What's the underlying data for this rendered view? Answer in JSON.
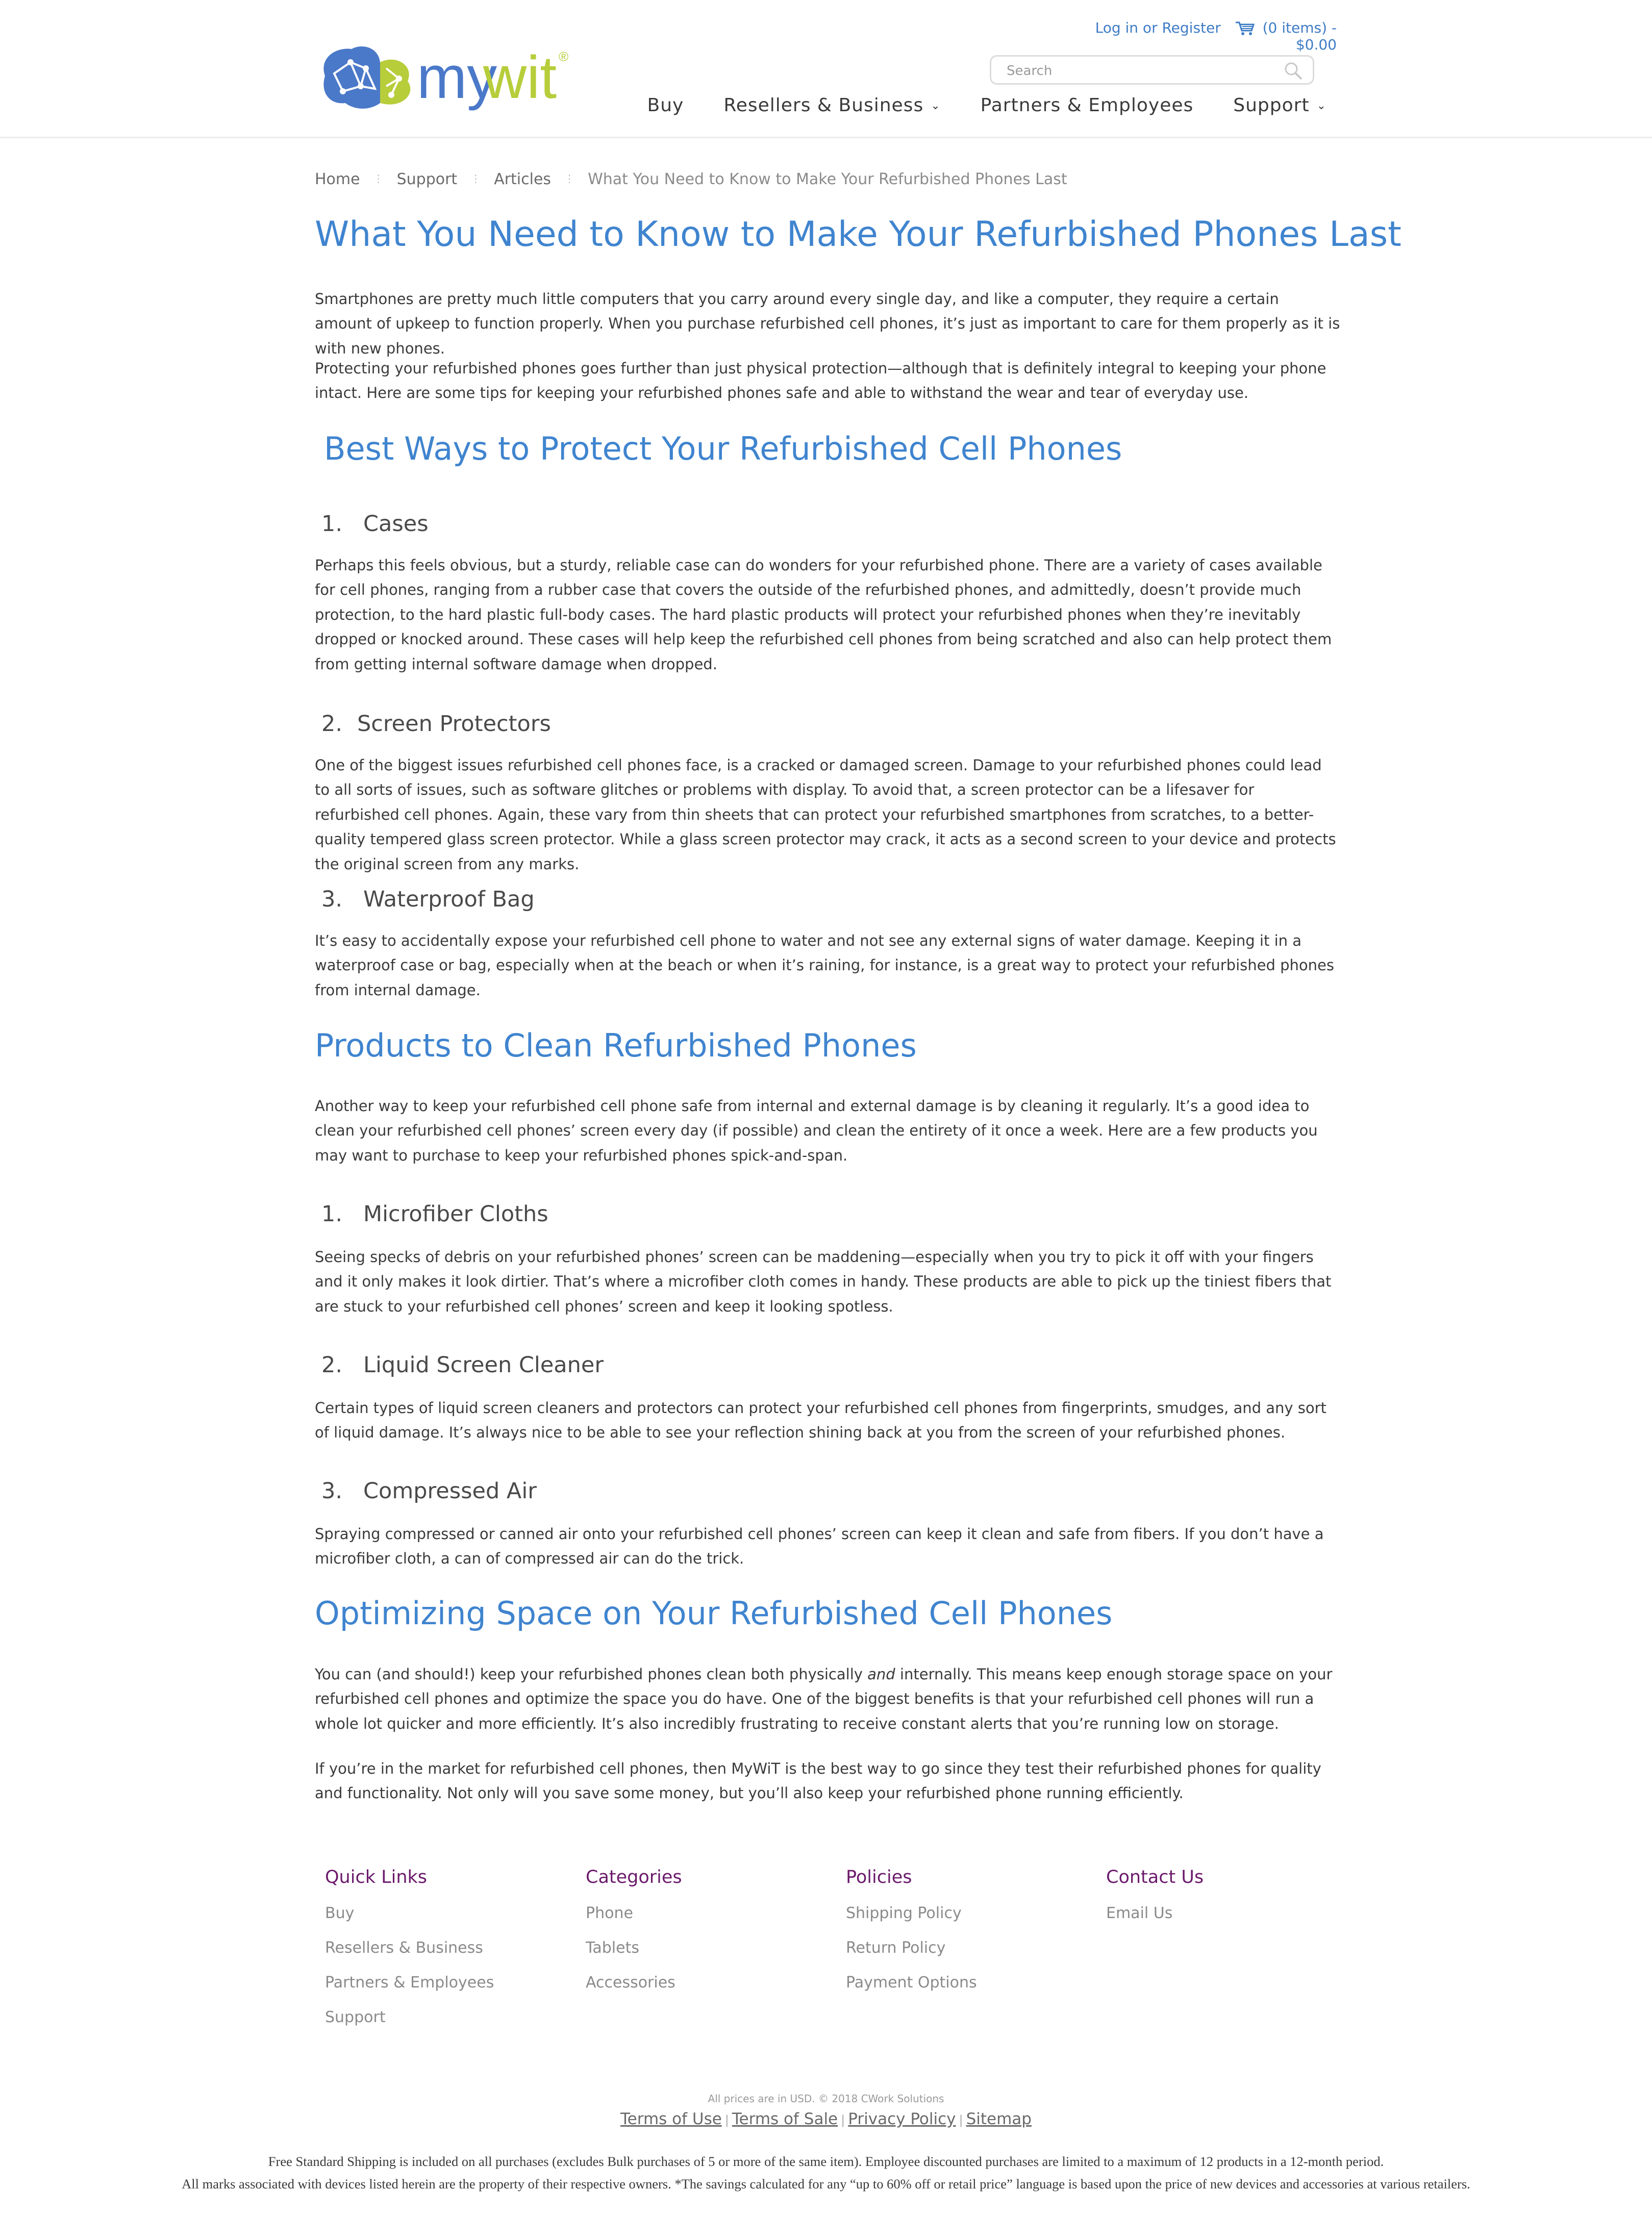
{
  "header": {
    "logo_text_my": "my",
    "logo_text_wit": "wit",
    "logo_mark": "®",
    "login": "Log in or Register",
    "cart": "(0 items) - $0.00",
    "search_placeholder": "Search",
    "nav": [
      {
        "label": "Buy",
        "dropdown": false
      },
      {
        "label": "Resellers & Business",
        "dropdown": true
      },
      {
        "label": "Partners & Employees",
        "dropdown": false
      },
      {
        "label": "Support",
        "dropdown": true
      }
    ]
  },
  "breadcrumb": [
    "Home",
    "Support",
    "Articles",
    "What You Need to Know to Make Your Refurbished Phones Last"
  ],
  "article": {
    "title": "What You Need to Know to Make Your Refurbished Phones Last",
    "intro1": " Smartphones are pretty much little computers that you carry around every single day, and like a computer, they require a certain amount of upkeep to function properly. When you purchase refurbished cell phones, it’s just as important to care for them properly as it is with new phones.",
    "intro2": " Protecting your refurbished phones goes further than just physical protection—although that is definitely integral to keeping your phone intact. Here are some tips for keeping your refurbished phones safe and able to withstand the wear and tear of everyday use.",
    "s1_title": "Best Ways to Protect Your Refurbished Cell Phones",
    "s1_items": [
      {
        "num": "1.",
        "title": "Cases",
        "text": " Perhaps this feels obvious, but a sturdy, reliable case can do wonders for your refurbished phone. There are a variety of cases available for cell phones, ranging from a rubber case that covers the outside of the refurbished phones, and admittedly, doesn’t provide much protection, to the hard plastic full-body cases. The hard plastic products will protect your refurbished phones when they’re inevitably dropped or knocked around. These cases will help keep the refurbished cell phones from being scratched and also can help protect them from getting internal software damage when dropped."
      },
      {
        "num": "2.",
        "title": "Screen Protectors",
        "text": " One of the biggest issues refurbished cell phones face, is a cracked or damaged screen. Damage to your refurbished phones could lead to all sorts of issues, such as software glitches or problems with display. To avoid that, a screen protector can be a lifesaver for refurbished cell phones. Again, these vary from thin sheets that can protect your refurbished smartphones from scratches, to a better-quality tempered glass screen protector. While a glass screen protector may crack, it acts as a second screen to your device and protects the original screen from any marks."
      },
      {
        "num": "3.",
        "title": "Waterproof Bag",
        "text": " It’s easy to accidentally expose your refurbished cell phone to water and not see any external signs of water damage. Keeping it in a waterproof case or bag, especially when at the beach or when it’s raining, for instance, is a great way to protect your refurbished phones from internal damage."
      }
    ],
    "s2_title": "Products to Clean Refurbished Phones",
    "s2_intro": " Another way to keep your refurbished cell phone safe from internal and external damage is by cleaning it regularly. It’s a good idea to clean your refurbished cell phones’ screen every day (if possible) and clean the entirety of it once a week. Here are a few products you may want to purchase to keep your refurbished phones spick-and-span.",
    "s2_items": [
      {
        "num": "1.",
        "title": "Microfiber Cloths",
        "text": " Seeing specks of debris on your refurbished phones’ screen can be maddening—especially when you try to pick it off with your fingers and it only makes it look dirtier. That’s where a microfiber cloth comes in handy. These products are able to pick up the tiniest fibers that are stuck to your refurbished cell phones’ screen and keep it looking spotless."
      },
      {
        "num": "2.",
        "title": "Liquid Screen Cleaner",
        "text": " Certain types of liquid screen cleaners and protectors can protect your refurbished cell phones from fingerprints, smudges, and any sort of liquid damage. It’s always nice to be able to see your reflection shining back at you from the screen of your refurbished phones."
      },
      {
        "num": "3.",
        "title": "Compressed Air",
        "text": " Spraying compressed or canned air onto your refurbished cell phones’ screen can keep it clean and safe from fibers. If you don’t have a microfiber cloth, a can of compressed air can do the trick."
      }
    ],
    "s3_title": "Optimizing Space on Your Refurbished Cell Phones",
    "s3_p1_a": " You can (and should!) keep your refurbished phones clean both physically ",
    "s3_p1_em": "and",
    "s3_p1_b": " internally. This means keep enough storage space on your refurbished cell phones and optimize the space you do have. One of the biggest benefits is that your refurbished cell phones will run a whole lot quicker and more efficiently. It’s also incredibly frustrating to receive constant alerts that you’re running low on storage.",
    "s3_p2": " If you’re in the market for refurbished cell phones, then MyWiT is the best way to go since they test their refurbished phones for quality and functionality. Not only will you save some money, but you’ll also keep your refurbished phone running efficiently."
  },
  "footer": {
    "columns": [
      {
        "title": "Quick Links",
        "links": [
          "Buy",
          "Resellers & Business",
          "Partners & Employees",
          "Support"
        ]
      },
      {
        "title": "Categories",
        "links": [
          "Phone",
          "Tablets",
          "Accessories"
        ]
      },
      {
        "title": "Policies",
        "links": [
          "Shipping Policy",
          "Return Policy",
          "Payment Options"
        ]
      },
      {
        "title": "Contact Us",
        "links": [
          "Email Us"
        ]
      }
    ],
    "copyright": "All prices are in USD. © 2018 CWork Solutions",
    "bottom_links": [
      "Terms of Use",
      "Terms of Sale",
      "Privacy Policy",
      "Sitemap"
    ],
    "legal1": "Free Standard Shipping is included on all purchases (excludes Bulk purchases of 5 or more of the same item). Employee discounted purchases are limited to a maximum of 12 products in a 12-month period.",
    "legal2": "All marks associated with devices listed herein are the property of their respective owners. *The savings calculated for any “up to 60% off or retail price” language is based upon the price of new devices and accessories at various retailers."
  },
  "colors": {
    "accent": "#3f84cf",
    "logo_blue": "#4b79c9",
    "logo_green": "#b7cd3a",
    "footer_heading": "#6b1a6b"
  }
}
